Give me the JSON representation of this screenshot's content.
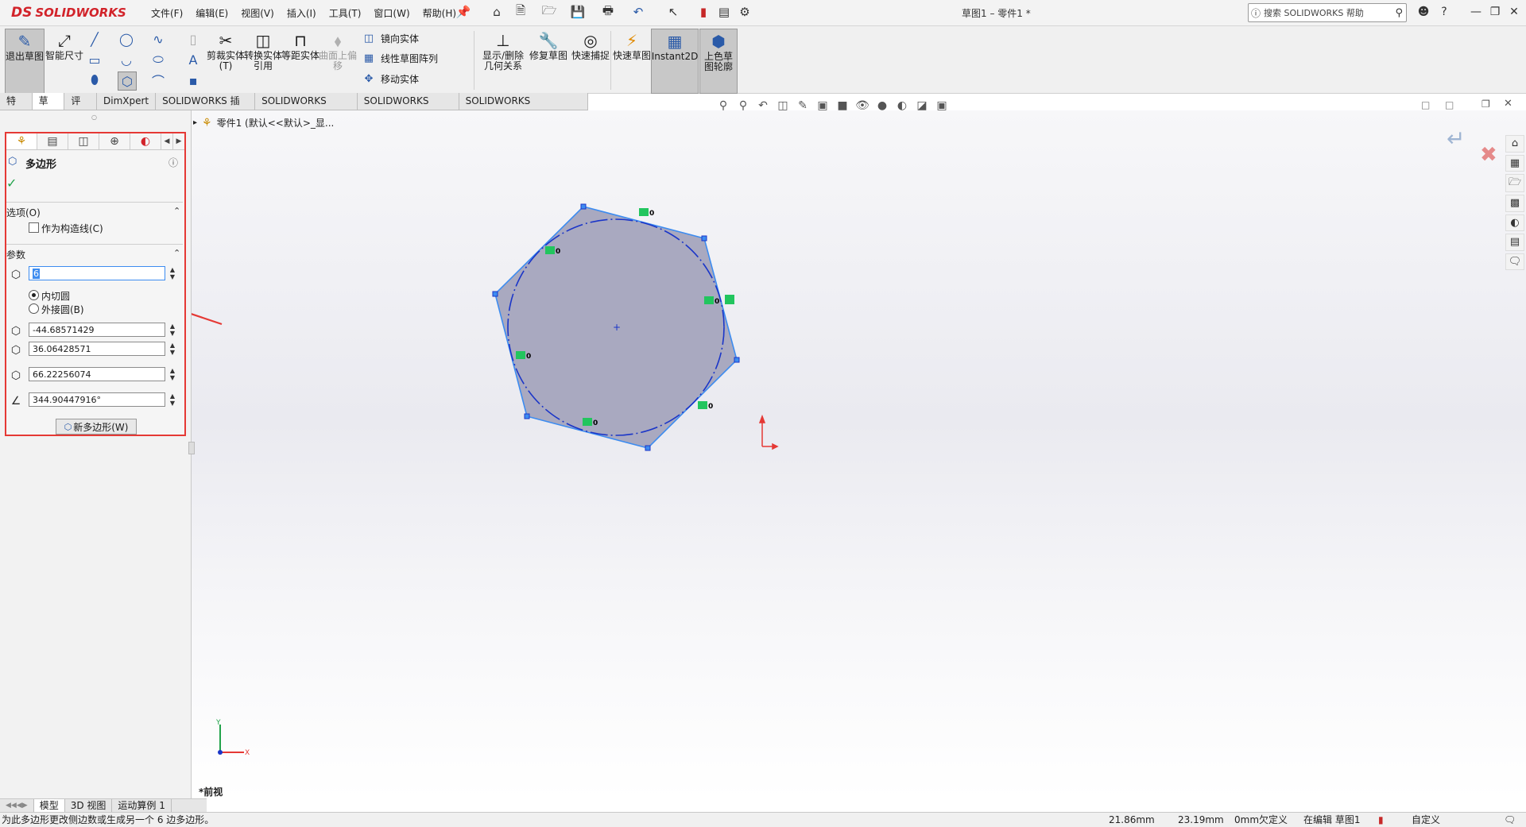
{
  "app": {
    "brand_mark": "DS",
    "brand": "SOLIDWORKS"
  },
  "menu": [
    "文件(F)",
    "编辑(E)",
    "视图(V)",
    "插入(I)",
    "工具(T)",
    "窗口(W)",
    "帮助(H)"
  ],
  "doc_title": "草图1 – 零件1 *",
  "help_search": {
    "placeholder": "搜索 SOLIDWORKS 帮助"
  },
  "commands": {
    "exit_sketch": "退出草图",
    "smart_dim": "智能尺寸",
    "trim": "剪裁实体(T)",
    "convert": "转换实体引用",
    "offset": "等距实体",
    "offset_surface": "曲面上偏移",
    "mirror": "镜向实体",
    "linear_pattern": "线性草图阵列",
    "move": "移动实体",
    "show_relations": "显示/删除几何关系",
    "repair": "修复草图",
    "quick_snaps": "快速捕捉",
    "rapid_sketch": "快速草图",
    "instant2d": "Instant2D",
    "shaded_contours": "上色草图轮廓"
  },
  "command_tabs": [
    "特征",
    "草图",
    "评估",
    "DimXpert",
    "SOLIDWORKS 插件",
    "SOLIDWORKS MBD",
    "SOLIDWORKS CAM",
    "SOLIDWORKS Inspection"
  ],
  "active_command_tab": "草图",
  "breadcrumb": "零件1  (默认<<默认>_显...",
  "property_manager": {
    "title": "多边形",
    "options_header": "选项(O)",
    "construction_label": "作为构造线(C)",
    "construction_checked": false,
    "params_header": "参数",
    "sides_value": "6",
    "inscribed_label": "内切圆",
    "circumscribed_label": "外接圆(B)",
    "inscribed_selected": true,
    "center_x": "-44.68571429",
    "center_y": "36.06428571",
    "diameter": "66.22256074",
    "angle": "344.90447916°",
    "new_polygon_button": "新多边形(W)"
  },
  "annotation_color": "#e53935",
  "view_name": "*前视",
  "bottom_tabs": [
    "模型",
    "3D 视图",
    "运动算例 1"
  ],
  "status": {
    "message": "为此多边形更改侧边数或生成另一个 6 边多边形。",
    "x": "21.86mm",
    "y": "23.19mm",
    "z": "0mm",
    "defined": "欠定义",
    "editing": "在编辑 草图1",
    "units": "自定义"
  },
  "accent": "#2a5aa8",
  "sketch_fill": "#a9a9c0",
  "sketch_line": "#1a35c8"
}
